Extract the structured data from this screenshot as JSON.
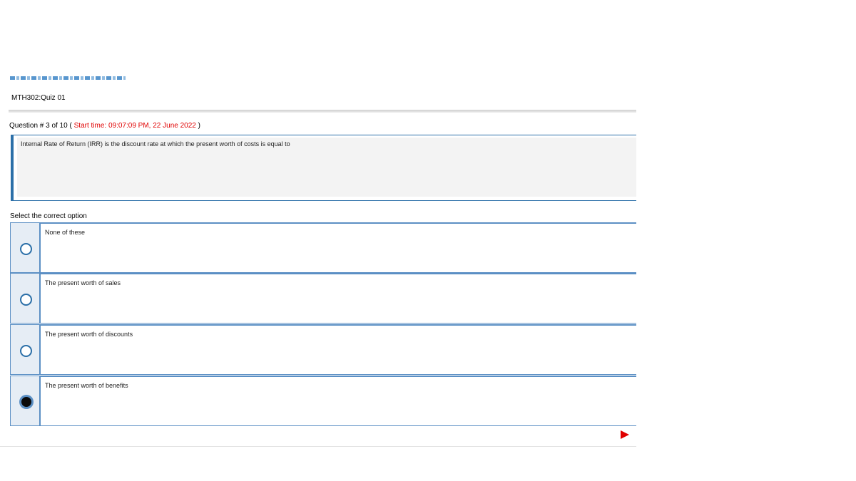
{
  "quiz": {
    "title": "MTH302:Quiz 01"
  },
  "question": {
    "header_prefix": "Question # 3 of 10 ( ",
    "start_time": "Start time: 09:07:09 PM, 22 June 2022",
    "header_suffix": " )",
    "text": "Internal Rate of Return (IRR) is the discount rate at which the present worth of costs is equal to"
  },
  "options": {
    "label": "Select the correct option",
    "items": [
      {
        "text": "None of these",
        "selected": false
      },
      {
        "text": "The present worth of sales",
        "selected": false
      },
      {
        "text": "The present worth of discounts",
        "selected": false
      },
      {
        "text": "The present worth of benefits",
        "selected": true
      }
    ]
  },
  "navigation": {
    "next_icon": "play-arrow-icon",
    "next_color": "#e00000"
  },
  "colors": {
    "accent": "#2b6fa8",
    "start_time": "#e00000"
  }
}
